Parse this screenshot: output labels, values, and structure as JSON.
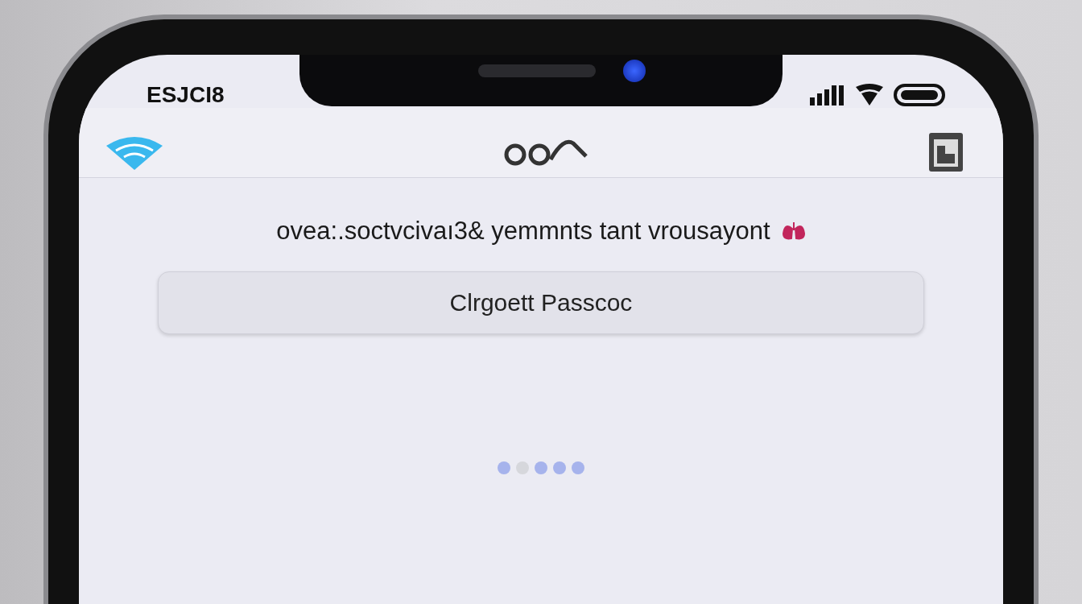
{
  "status_bar": {
    "time": "ESJCI8"
  },
  "message": "ovea:.soctvcivaı3& yemmnts tant vrousayont",
  "button": {
    "label": "Clrgoett Passcoc"
  },
  "page_dots": [
    {
      "filled": true
    },
    {
      "filled": false
    },
    {
      "filled": true
    },
    {
      "filled": true
    },
    {
      "filled": true
    }
  ]
}
